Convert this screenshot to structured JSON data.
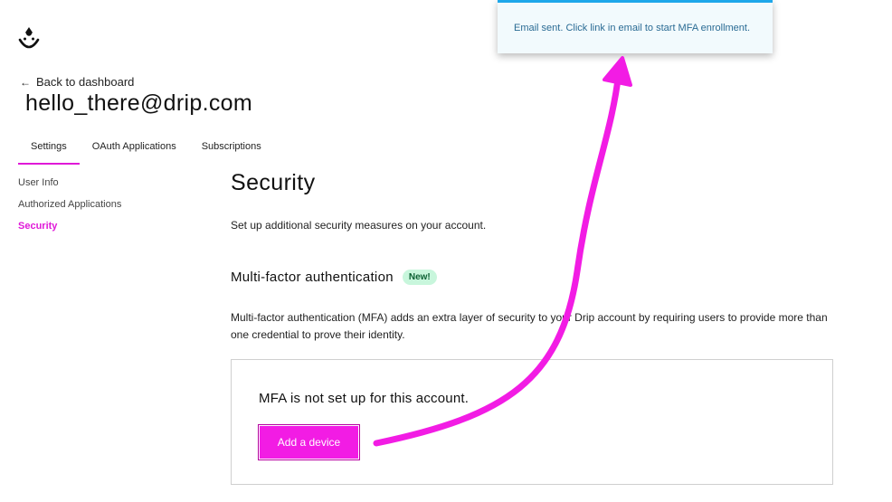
{
  "header": {
    "logo_icon": "drip-smiley-logo-icon",
    "back_link": "Back to dashboard",
    "account_email": "hello_there@drip.com"
  },
  "tabs": [
    {
      "label": "Settings",
      "active": true
    },
    {
      "label": "OAuth Applications",
      "active": false
    },
    {
      "label": "Subscriptions",
      "active": false
    }
  ],
  "sidenav": {
    "items": [
      {
        "label": "User Info",
        "active": false
      },
      {
        "label": "Authorized Applications",
        "active": false
      },
      {
        "label": "Security",
        "active": true
      }
    ]
  },
  "main": {
    "title": "Security",
    "description": "Set up additional security measures on your account.",
    "mfa": {
      "heading": "Multi-factor authentication",
      "badge": "New!",
      "description": "Multi-factor authentication (MFA) adds an extra layer of security to your Drip account by requiring users to provide more than one credential to prove their identity.",
      "status_text": "MFA is not set up for this account.",
      "add_button": "Add a device"
    }
  },
  "toast": {
    "message": "Email sent. Click link in email to start MFA enrollment."
  },
  "colors": {
    "accent": "#e019d8",
    "button": "#f21ce4",
    "toast_border": "#1ea7ea",
    "badge_bg": "#c8f6dc",
    "annotation_arrow": "#f21ce4"
  }
}
